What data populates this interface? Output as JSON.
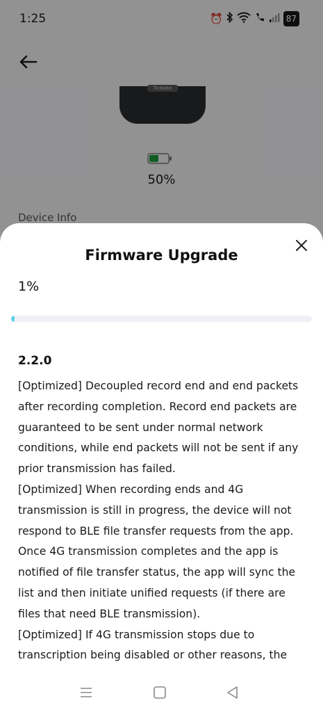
{
  "status_bar": {
    "time": "1:25",
    "battery": "87",
    "icons": [
      "alarm-icon",
      "bluetooth-icon",
      "wifi-icon",
      "call-icon",
      "signal-icon",
      "battery-icon"
    ]
  },
  "device": {
    "logo_text": "TicNote",
    "battery_percent": "50%",
    "battery_level": 0.5,
    "info_label": "Device Info"
  },
  "sheet": {
    "title": "Firmware Upgrade",
    "progress_text": "1%",
    "progress_value": 0.01,
    "version": "2.2.0",
    "notes": [
      "[Optimized] Decoupled record end and end packets after recording completion. Record end packets are guaranteed to be sent under normal network conditions, while end packets will not be sent if any prior transmission has failed.",
      "[Optimized] When recording ends and 4G transmission is still in progress, the device will not respond to BLE file transfer requests from the app. Once 4G transmission completes and the app is notified of file transfer status, the app will sync the list and then initiate unified requests (if there are files that need BLE transmission).",
      "[Optimized] If 4G transmission stops due to transcription being disabled or other reasons, the"
    ]
  },
  "colors": {
    "progress_fill": "#5fd0e6",
    "progress_track": "#eef0f5",
    "battery_green": "#1e9a3a"
  },
  "nav_bar": {
    "icons": [
      "menu-icon",
      "home-icon",
      "back-icon"
    ]
  }
}
